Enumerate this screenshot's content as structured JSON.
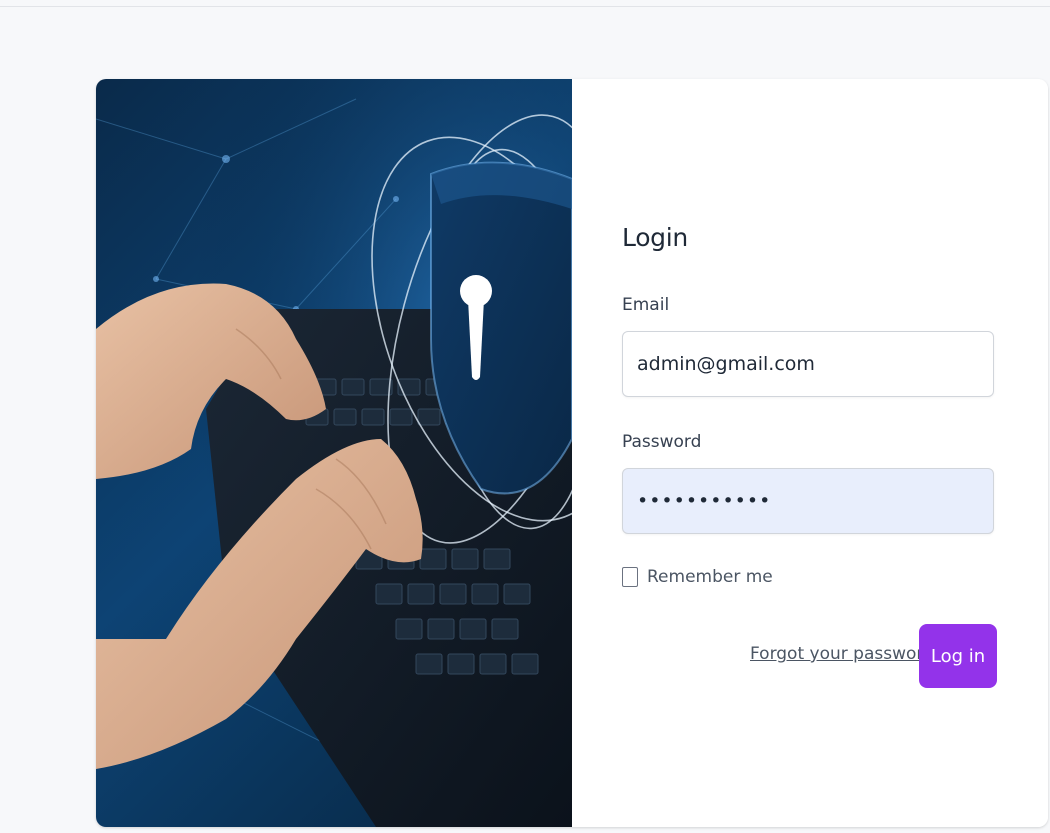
{
  "form": {
    "title": "Login",
    "email_label": "Email",
    "email_value": "admin@gmail.com",
    "password_label": "Password",
    "password_value": "•••••••••••",
    "remember_label": "Remember me",
    "remember_checked": false,
    "forgot_link": "Forgot your password?",
    "login_button": "Log in"
  },
  "colors": {
    "accent": "#9333ea",
    "password_autofill_bg": "#e8eefc",
    "page_bg": "#f7f8fa"
  },
  "hero": {
    "image_subject": "hands typing on laptop keyboard with security shield and keyhole icon"
  }
}
